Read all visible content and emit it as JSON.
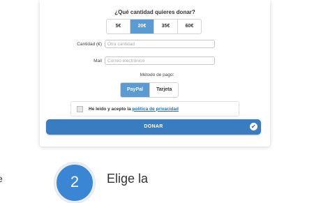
{
  "form": {
    "question": "¿Qué cantidad quieres donar?",
    "amounts": [
      "5€",
      "20€",
      "35€",
      "60€"
    ],
    "selected_amount": "20€",
    "amount_label": "Cantidad (€)",
    "amount_placeholder": "Otra cantidad",
    "mail_label": "Mail",
    "mail_placeholder": "Correo electrónico",
    "payment_label": "Método de pago:",
    "payment_methods": [
      "PayPal",
      "Tarjeta"
    ],
    "selected_payment": "PayPal",
    "terms_text": "He leído y acepto la",
    "terms_link": "política de privacidad",
    "donate_label": "DONAR",
    "donate_icon": "check-circle-icon"
  },
  "step": {
    "number": "2",
    "text": "Elige la",
    "edge_text": "e"
  },
  "colors": {
    "accent": "#5a9bd4",
    "button": "#3a7cc0",
    "step_circle": "#3a86d4",
    "link": "#2b6cb0"
  }
}
